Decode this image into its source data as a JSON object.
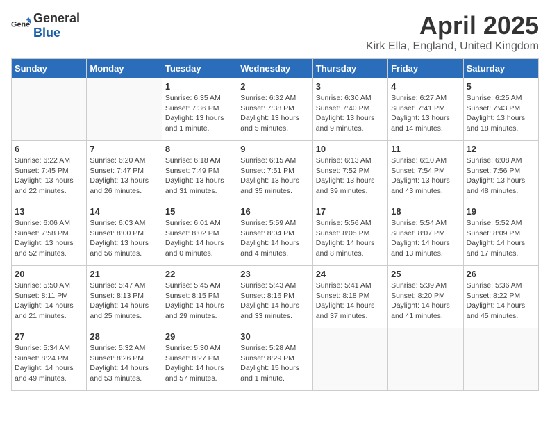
{
  "logo": {
    "general": "General",
    "blue": "Blue"
  },
  "title": "April 2025",
  "location": "Kirk Ella, England, United Kingdom",
  "days_of_week": [
    "Sunday",
    "Monday",
    "Tuesday",
    "Wednesday",
    "Thursday",
    "Friday",
    "Saturday"
  ],
  "weeks": [
    [
      {
        "day": "",
        "info": ""
      },
      {
        "day": "",
        "info": ""
      },
      {
        "day": "1",
        "info": "Sunrise: 6:35 AM\nSunset: 7:36 PM\nDaylight: 13 hours and 1 minute."
      },
      {
        "day": "2",
        "info": "Sunrise: 6:32 AM\nSunset: 7:38 PM\nDaylight: 13 hours and 5 minutes."
      },
      {
        "day": "3",
        "info": "Sunrise: 6:30 AM\nSunset: 7:40 PM\nDaylight: 13 hours and 9 minutes."
      },
      {
        "day": "4",
        "info": "Sunrise: 6:27 AM\nSunset: 7:41 PM\nDaylight: 13 hours and 14 minutes."
      },
      {
        "day": "5",
        "info": "Sunrise: 6:25 AM\nSunset: 7:43 PM\nDaylight: 13 hours and 18 minutes."
      }
    ],
    [
      {
        "day": "6",
        "info": "Sunrise: 6:22 AM\nSunset: 7:45 PM\nDaylight: 13 hours and 22 minutes."
      },
      {
        "day": "7",
        "info": "Sunrise: 6:20 AM\nSunset: 7:47 PM\nDaylight: 13 hours and 26 minutes."
      },
      {
        "day": "8",
        "info": "Sunrise: 6:18 AM\nSunset: 7:49 PM\nDaylight: 13 hours and 31 minutes."
      },
      {
        "day": "9",
        "info": "Sunrise: 6:15 AM\nSunset: 7:51 PM\nDaylight: 13 hours and 35 minutes."
      },
      {
        "day": "10",
        "info": "Sunrise: 6:13 AM\nSunset: 7:52 PM\nDaylight: 13 hours and 39 minutes."
      },
      {
        "day": "11",
        "info": "Sunrise: 6:10 AM\nSunset: 7:54 PM\nDaylight: 13 hours and 43 minutes."
      },
      {
        "day": "12",
        "info": "Sunrise: 6:08 AM\nSunset: 7:56 PM\nDaylight: 13 hours and 48 minutes."
      }
    ],
    [
      {
        "day": "13",
        "info": "Sunrise: 6:06 AM\nSunset: 7:58 PM\nDaylight: 13 hours and 52 minutes."
      },
      {
        "day": "14",
        "info": "Sunrise: 6:03 AM\nSunset: 8:00 PM\nDaylight: 13 hours and 56 minutes."
      },
      {
        "day": "15",
        "info": "Sunrise: 6:01 AM\nSunset: 8:02 PM\nDaylight: 14 hours and 0 minutes."
      },
      {
        "day": "16",
        "info": "Sunrise: 5:59 AM\nSunset: 8:04 PM\nDaylight: 14 hours and 4 minutes."
      },
      {
        "day": "17",
        "info": "Sunrise: 5:56 AM\nSunset: 8:05 PM\nDaylight: 14 hours and 8 minutes."
      },
      {
        "day": "18",
        "info": "Sunrise: 5:54 AM\nSunset: 8:07 PM\nDaylight: 14 hours and 13 minutes."
      },
      {
        "day": "19",
        "info": "Sunrise: 5:52 AM\nSunset: 8:09 PM\nDaylight: 14 hours and 17 minutes."
      }
    ],
    [
      {
        "day": "20",
        "info": "Sunrise: 5:50 AM\nSunset: 8:11 PM\nDaylight: 14 hours and 21 minutes."
      },
      {
        "day": "21",
        "info": "Sunrise: 5:47 AM\nSunset: 8:13 PM\nDaylight: 14 hours and 25 minutes."
      },
      {
        "day": "22",
        "info": "Sunrise: 5:45 AM\nSunset: 8:15 PM\nDaylight: 14 hours and 29 minutes."
      },
      {
        "day": "23",
        "info": "Sunrise: 5:43 AM\nSunset: 8:16 PM\nDaylight: 14 hours and 33 minutes."
      },
      {
        "day": "24",
        "info": "Sunrise: 5:41 AM\nSunset: 8:18 PM\nDaylight: 14 hours and 37 minutes."
      },
      {
        "day": "25",
        "info": "Sunrise: 5:39 AM\nSunset: 8:20 PM\nDaylight: 14 hours and 41 minutes."
      },
      {
        "day": "26",
        "info": "Sunrise: 5:36 AM\nSunset: 8:22 PM\nDaylight: 14 hours and 45 minutes."
      }
    ],
    [
      {
        "day": "27",
        "info": "Sunrise: 5:34 AM\nSunset: 8:24 PM\nDaylight: 14 hours and 49 minutes."
      },
      {
        "day": "28",
        "info": "Sunrise: 5:32 AM\nSunset: 8:26 PM\nDaylight: 14 hours and 53 minutes."
      },
      {
        "day": "29",
        "info": "Sunrise: 5:30 AM\nSunset: 8:27 PM\nDaylight: 14 hours and 57 minutes."
      },
      {
        "day": "30",
        "info": "Sunrise: 5:28 AM\nSunset: 8:29 PM\nDaylight: 15 hours and 1 minute."
      },
      {
        "day": "",
        "info": ""
      },
      {
        "day": "",
        "info": ""
      },
      {
        "day": "",
        "info": ""
      }
    ]
  ]
}
